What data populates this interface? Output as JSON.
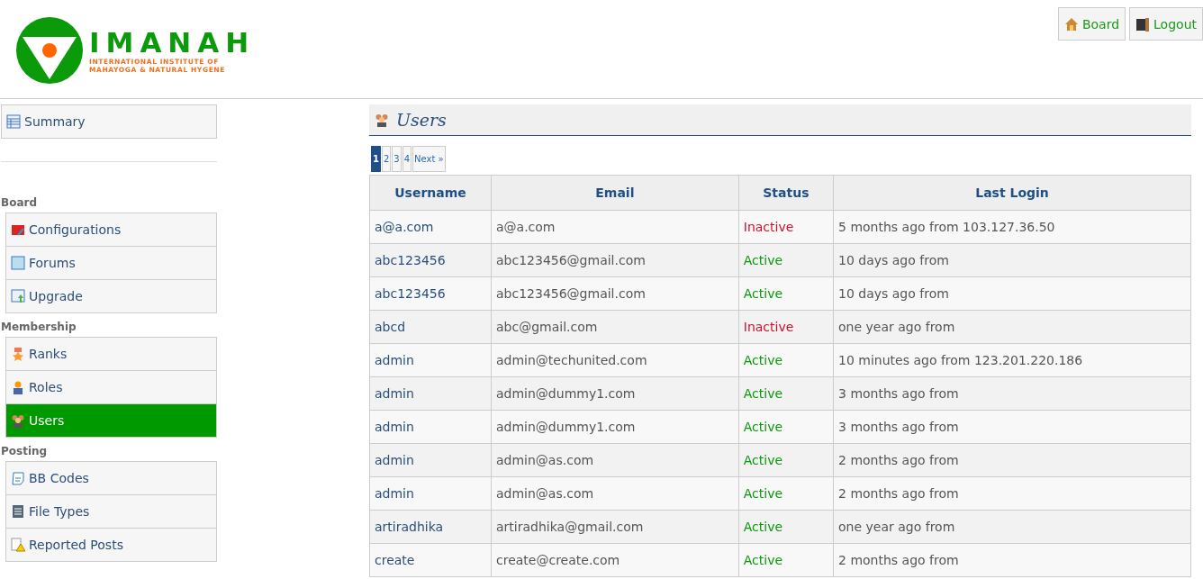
{
  "logo": {
    "title": "IMANAH",
    "subtitle_lines": [
      "INTERNATIONAL INSTITUTE OF",
      "MAHAYOGA & NATURAL HYGENE"
    ]
  },
  "header_buttons": [
    {
      "label": "Board"
    },
    {
      "label": "Logout"
    }
  ],
  "sidebar": {
    "summary": {
      "label": "Summary",
      "selected": false
    },
    "sections": [
      {
        "heading": "Board",
        "items": [
          {
            "label": "Configurations",
            "selected": false
          },
          {
            "label": "Forums",
            "selected": false
          },
          {
            "label": "Upgrade",
            "selected": false
          }
        ]
      },
      {
        "heading": "Membership",
        "items": [
          {
            "label": "Ranks",
            "selected": false
          },
          {
            "label": "Roles",
            "selected": false
          },
          {
            "label": "Users",
            "selected": true
          }
        ]
      },
      {
        "heading": "Posting",
        "items": [
          {
            "label": "BB Codes",
            "selected": false
          },
          {
            "label": "File Types",
            "selected": false
          },
          {
            "label": "Reported Posts",
            "selected": false
          }
        ]
      }
    ]
  },
  "page_title": "Users",
  "pagination": [
    {
      "label": "1",
      "selected": true
    },
    {
      "label": "2",
      "selected": false
    },
    {
      "label": "3",
      "selected": false
    },
    {
      "label": "4",
      "selected": false
    },
    {
      "label": "Next »",
      "selected": false
    }
  ],
  "table": {
    "columns": [
      "Username",
      "Email",
      "Status",
      "Last Login"
    ],
    "rows": [
      {
        "username": "a@a.com",
        "email": "a@a.com",
        "status": "Inactive",
        "active": false,
        "last_login": "5 months ago from 103.127.36.50"
      },
      {
        "username": "abc123456",
        "email": "abc123456@gmail.com",
        "status": "Active",
        "active": true,
        "last_login": "10 days ago from"
      },
      {
        "username": "abc123456",
        "email": "abc123456@gmail.com",
        "status": "Active",
        "active": true,
        "last_login": "10 days ago from"
      },
      {
        "username": "abcd",
        "email": "abc@gmail.com",
        "status": "Inactive",
        "active": false,
        "last_login": "one year ago from"
      },
      {
        "username": "admin",
        "email": "admin@techunited.com",
        "status": "Active",
        "active": true,
        "last_login": "10 minutes ago from 123.201.220.186"
      },
      {
        "username": "admin",
        "email": "admin@dummy1.com",
        "status": "Active",
        "active": true,
        "last_login": "3 months ago from"
      },
      {
        "username": "admin",
        "email": "admin@dummy1.com",
        "status": "Active",
        "active": true,
        "last_login": "3 months ago from"
      },
      {
        "username": "admin",
        "email": "admin@as.com",
        "status": "Active",
        "active": true,
        "last_login": "2 months ago from"
      },
      {
        "username": "admin",
        "email": "admin@as.com",
        "status": "Active",
        "active": true,
        "last_login": "2 months ago from"
      },
      {
        "username": "artiradhika",
        "email": "artiradhika@gmail.com",
        "status": "Active",
        "active": true,
        "last_login": "one year ago from"
      },
      {
        "username": "create",
        "email": "create@create.com",
        "status": "Active",
        "active": true,
        "last_login": "2 months ago from"
      }
    ]
  }
}
